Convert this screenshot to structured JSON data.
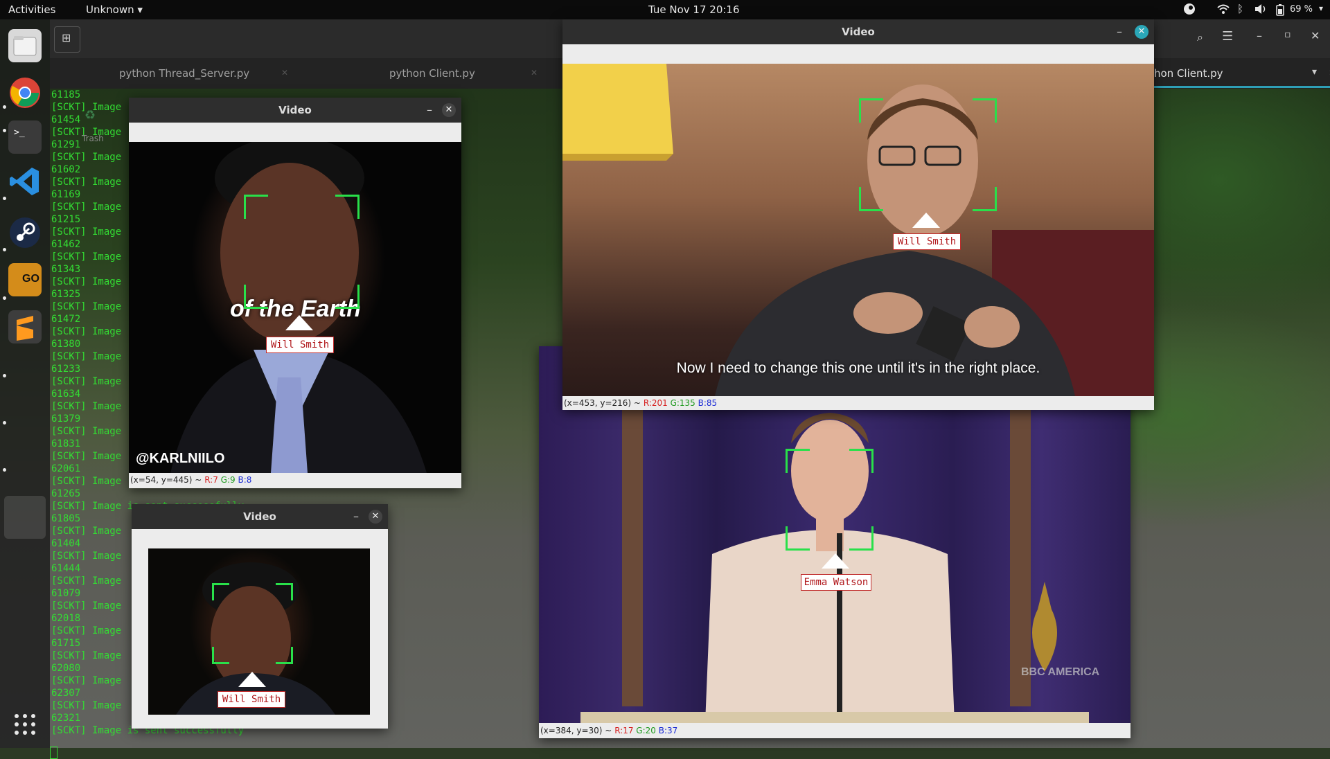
{
  "topbar": {
    "activities": "Activities",
    "app_menu": "Unknown",
    "clock": "Tue Nov 17  20:16",
    "battery": "69 %"
  },
  "terminal": {
    "tabs": [
      {
        "label": "python Thread_Server.py"
      },
      {
        "label": "python Client.py"
      },
      {
        "label": "hon Client.py"
      }
    ],
    "lines": [
      "61185",
      "[SCKT] Image",
      "61454",
      "[SCKT] Image",
      "61291",
      "[SCKT] Image",
      "61602",
      "[SCKT] Image",
      "61169",
      "[SCKT] Image",
      "61215",
      "[SCKT] Image",
      "61462",
      "[SCKT] Image",
      "61343",
      "[SCKT] Image",
      "61325",
      "[SCKT] Image",
      "61472",
      "[SCKT] Image",
      "61380",
      "[SCKT] Image",
      "61233",
      "[SCKT] Image",
      "61634",
      "[SCKT] Image",
      "61379",
      "[SCKT] Image",
      "61831",
      "[SCKT] Image",
      "62061",
      "[SCKT] Image",
      "61265",
      "[SCKT] Image is sent successfully",
      "61805",
      "[SCKT] Image",
      "61404",
      "[SCKT] Image",
      "61444",
      "[SCKT] Image",
      "61079",
      "[SCKT] Image",
      "62018",
      "[SCKT] Image",
      "61715",
      "[SCKT] Image",
      "62080",
      "[SCKT] Image",
      "62307",
      "[SCKT] Image",
      "62321",
      "[SCKT] Image is sent successfully"
    ],
    "trash_label": "Trash"
  },
  "windows": {
    "top_right": {
      "title": "Video",
      "subtitle": "Now I need to change this one until it's in the right place.",
      "face_label": "Will Smith",
      "status_pos": "(x=453, y=216) ~",
      "status_r": "R:201",
      "status_g": "G:135",
      "status_b": "B:85"
    },
    "left": {
      "title": "Video",
      "overlay_text": "of the Earth",
      "watermark": "@KARLNIILO",
      "face_label": "Will Smith",
      "status_pos": "(x=54, y=445) ~",
      "status_r": "R:7",
      "status_g": "G:9",
      "status_b": "B:8"
    },
    "small": {
      "title": "Video",
      "face_label": "Will Smith"
    },
    "bottom_right": {
      "face_label": "Emma Watson",
      "logo": "BBC AMERICA",
      "status_pos": "(x=384, y=30) ~",
      "status_r": "R:17",
      "status_g": "G:20",
      "status_b": "B:37"
    }
  },
  "colors": {
    "terminal_text": "#33dd33",
    "face_bracket": "#29e04a",
    "label_border": "#c02a2a"
  }
}
